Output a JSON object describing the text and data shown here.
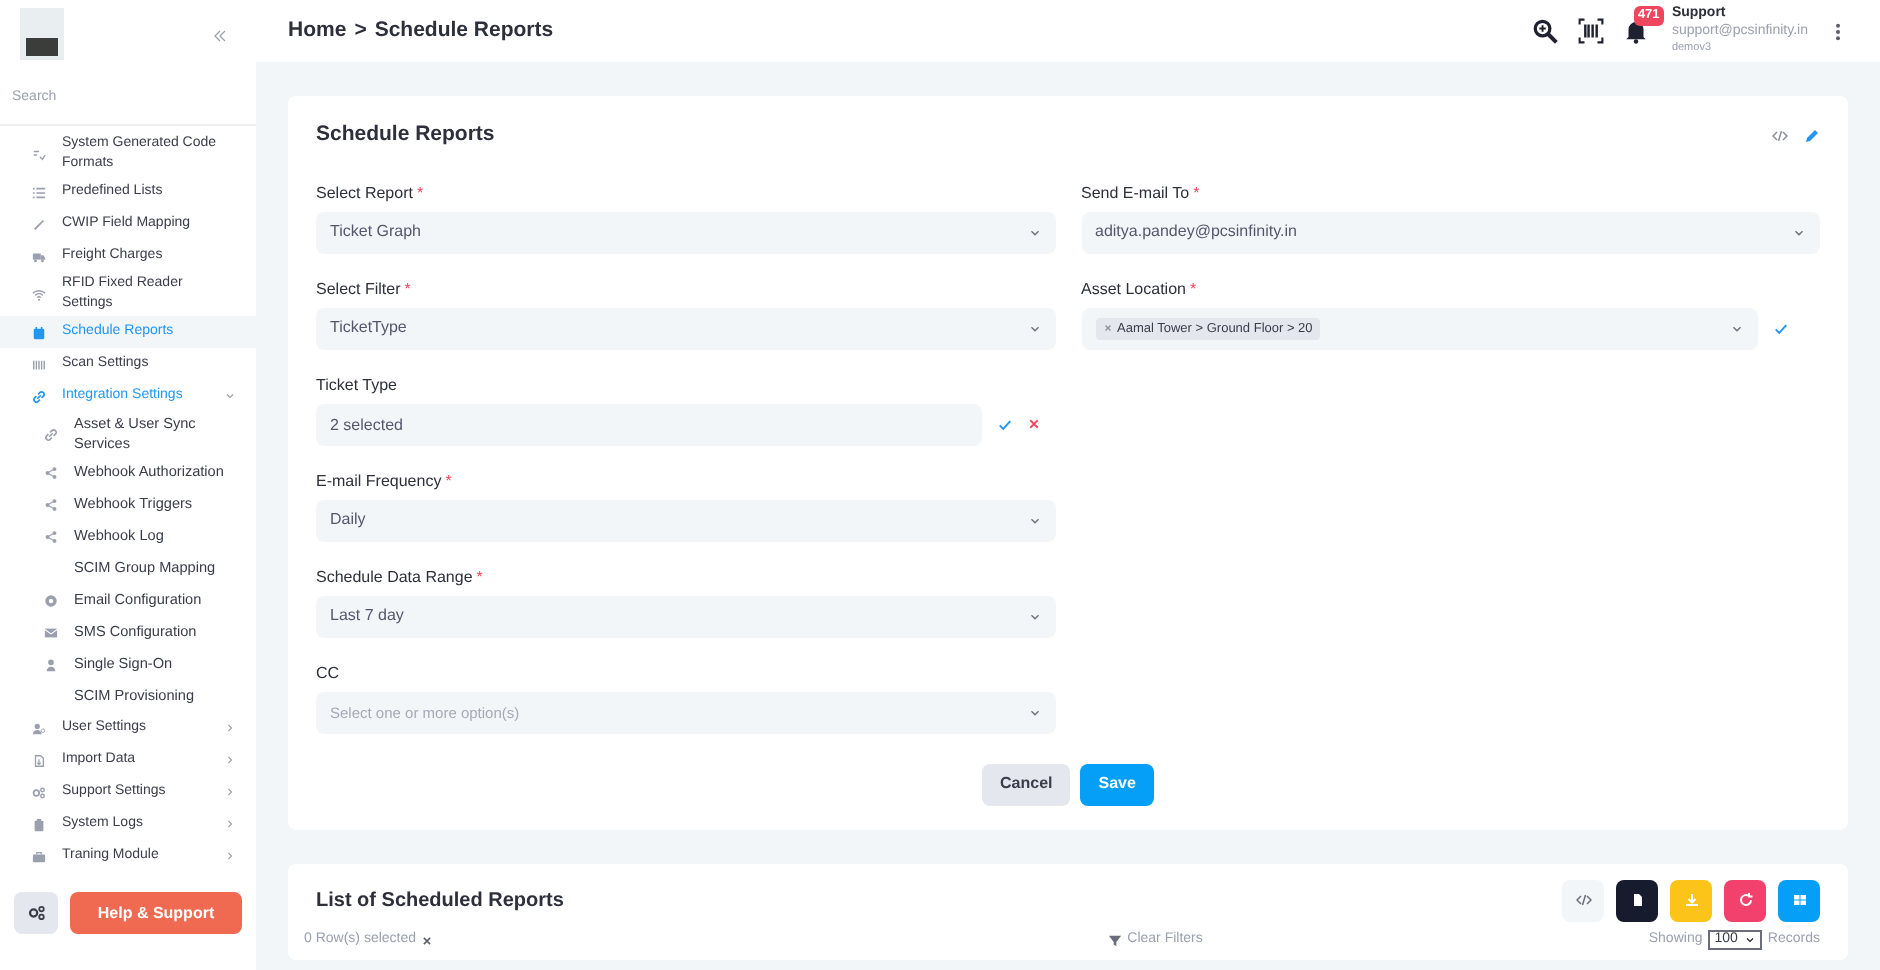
{
  "sidebar": {
    "search": {
      "placeholder": "Search"
    },
    "items": [
      {
        "label": "System Generated Code Formats",
        "selected": false
      },
      {
        "label": "Predefined Lists",
        "selected": false
      },
      {
        "label": "CWIP Field Mapping",
        "selected": false
      },
      {
        "label": "Freight Charges",
        "selected": false
      },
      {
        "label": "RFID Fixed Reader Settings",
        "selected": false
      },
      {
        "label": "Schedule Reports",
        "selected": true
      },
      {
        "label": "Scan Settings",
        "selected": false
      },
      {
        "label": "Integration Settings",
        "selected": false,
        "expanded": true,
        "children": [
          {
            "label": "Asset & User Sync Services",
            "has_icon": true
          },
          {
            "label": "Webhook Authorization",
            "has_icon": true
          },
          {
            "label": "Webhook Triggers",
            "has_icon": true
          },
          {
            "label": "Webhook Log",
            "has_icon": true
          },
          {
            "label": "SCIM Group Mapping",
            "has_icon": false
          },
          {
            "label": "Email Configuration",
            "has_icon": true
          },
          {
            "label": "SMS Configuration",
            "has_icon": true
          },
          {
            "label": "Single Sign-On",
            "has_icon": true
          },
          {
            "label": "SCIM Provisioning",
            "has_icon": false
          }
        ]
      },
      {
        "label": "User Settings",
        "selected": false,
        "expanded": false
      },
      {
        "label": "Import Data",
        "selected": false,
        "expanded": false
      },
      {
        "label": "Support Settings",
        "selected": false,
        "expanded": false
      },
      {
        "label": "System Logs",
        "selected": false,
        "expanded": false
      },
      {
        "label": "Traning Module",
        "selected": false,
        "expanded": false
      }
    ],
    "help_button": "Help & Support"
  },
  "header": {
    "breadcrumb": [
      "Home",
      "Schedule Reports"
    ],
    "separator": ">",
    "notification_count": "471",
    "user": {
      "name": "Support",
      "email": "support@pcsinfinity.in",
      "tenant": "demov3"
    }
  },
  "form": {
    "title": "Schedule Reports",
    "required_mark": "*",
    "left_fields": [
      {
        "label": "Select Report",
        "required": true,
        "kind": "select",
        "value": "Ticket Graph"
      },
      {
        "label": "Select Filter",
        "required": true,
        "kind": "select",
        "value": "TicketType"
      },
      {
        "label": "Ticket Type",
        "required": false,
        "kind": "text",
        "value": "2 selected",
        "confirm": true,
        "clear": true
      },
      {
        "label": "E-mail Frequency",
        "required": true,
        "kind": "select",
        "value": "Daily"
      },
      {
        "label": "Schedule Data Range",
        "required": true,
        "kind": "select",
        "value": "Last 7 day"
      },
      {
        "label": "CC",
        "required": false,
        "kind": "select",
        "placeholder": "Select one or more option(s)"
      }
    ],
    "right_fields": [
      {
        "label": "Send E-mail To",
        "required": true,
        "kind": "select",
        "value": "aditya.pandey@pcsinfinity.in"
      },
      {
        "label": "Asset Location",
        "required": true,
        "kind": "chips",
        "chips": [
          "Aamal Tower > Ground Floor > 20"
        ],
        "confirm": true
      }
    ],
    "buttons": [
      {
        "label": "Cancel",
        "kind": "secondary"
      },
      {
        "label": "Save",
        "kind": "primary"
      }
    ]
  },
  "list": {
    "title": "List of Scheduled Reports",
    "selection": "0 Row(s) selected",
    "clear_filters": "Clear Filters",
    "showing_label": "Showing",
    "page_size": "100",
    "records_label": "Records"
  }
}
